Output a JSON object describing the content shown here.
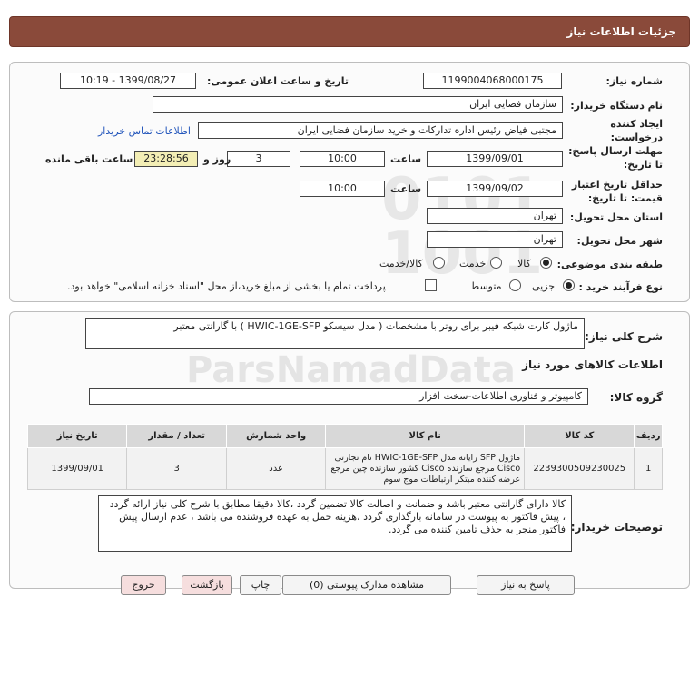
{
  "header": {
    "title": "جزئیات اطلاعات نیاز"
  },
  "details": {
    "need_number_label": "شماره نیاز:",
    "need_number": "1199004068000175",
    "announce_label": "تاریخ و ساعت اعلان عمومی:",
    "announce_value": "1399/08/27 - 10:19",
    "buyer_org_label": "نام دستگاه خریدار:",
    "buyer_org": "سازمان فضایی ایران",
    "creator_label": "ایجاد کننده درخواست:",
    "creator": "مجتبی  فیاض رئیس اداره تدارکات و خرید سازمان فضایی ایران",
    "contact_link": "اطلاعات تماس خریدار",
    "reply_deadline_label": "مهلت ارسال پاسخ: تا تاریخ:",
    "reply_date": "1399/09/01",
    "time_label": "ساعت",
    "reply_time": "10:00",
    "days_value": "3",
    "days_label": "روز و",
    "remaining_time": "23:28:56",
    "remaining_label": "ساعت باقی مانده",
    "validity_label": "حداقل تاریخ اعتبار قیمت: تا تاریخ:",
    "validity_date": "1399/09/02",
    "validity_time": "10:00",
    "province_label": "استان محل تحویل:",
    "province": "تهران",
    "city_label": "شهر محل تحویل:",
    "city": "تهران",
    "category_label": "طبقه بندی موضوعی:",
    "category_options": [
      "کالا",
      "خدمت",
      "کالا/خدمت"
    ],
    "process_label": "نوع فرآیند خرید :",
    "process_options": [
      "جزیی",
      "متوسط"
    ],
    "payment_note": "پرداخت تمام یا بخشی از مبلغ خرید،از محل \"اسناد خزانه اسلامی\" خواهد بود."
  },
  "summary": {
    "label": "شرح کلی نیاز:",
    "text": "ماژول کارت شبکه فیبر برای روتر با مشخصات ( مدل سیسکو HWIC-1GE-SFP ) با گارانتی معتبر"
  },
  "goods_section_title": "اطلاعات کالاهای مورد نیاز",
  "group": {
    "label": "گروه کالا:",
    "value": "کامپیوتر و فناوری اطلاعات-سخت افزار"
  },
  "table": {
    "headers": [
      "ردیف",
      "کد کالا",
      "نام کالا",
      "واحد شمارش",
      "تعداد / مقدار",
      "تاریخ نیاز"
    ],
    "rows": [
      {
        "index": "1",
        "code": "2239300509230025",
        "name": "ماژول SFP رایانه مدل HWIC-1GE-SFP نام تجارتی Cisco مرجع سازنده Cisco کشور سازنده چین مرجع عرضه کننده مبتکر ارتباطات موج سوم",
        "unit": "عدد",
        "qty": "3",
        "date": "1399/09/01"
      }
    ]
  },
  "buyer_notes": {
    "label": "توضیحات خریدار:",
    "text": "کالا دارای گارانتی معتبر باشد و ضمانت و اصالت کالا تضمین گردد ،کالا دقیقا مطابق با شرح کلی نیاز ارائه گردد ، پیش فاکتور به پیوست در سامانه بارگذاری گردد ،هزینه حمل به عهده فروشنده می باشد ، عدم ارسال پیش فاکتور منجر به حذف تامین کننده می گردد."
  },
  "buttons": {
    "reply": "پاسخ به نیاز",
    "attachments": "مشاهده مدارک پیوستی (0)",
    "print": "چاپ",
    "back": "بازگشت",
    "exit": "خروج"
  }
}
